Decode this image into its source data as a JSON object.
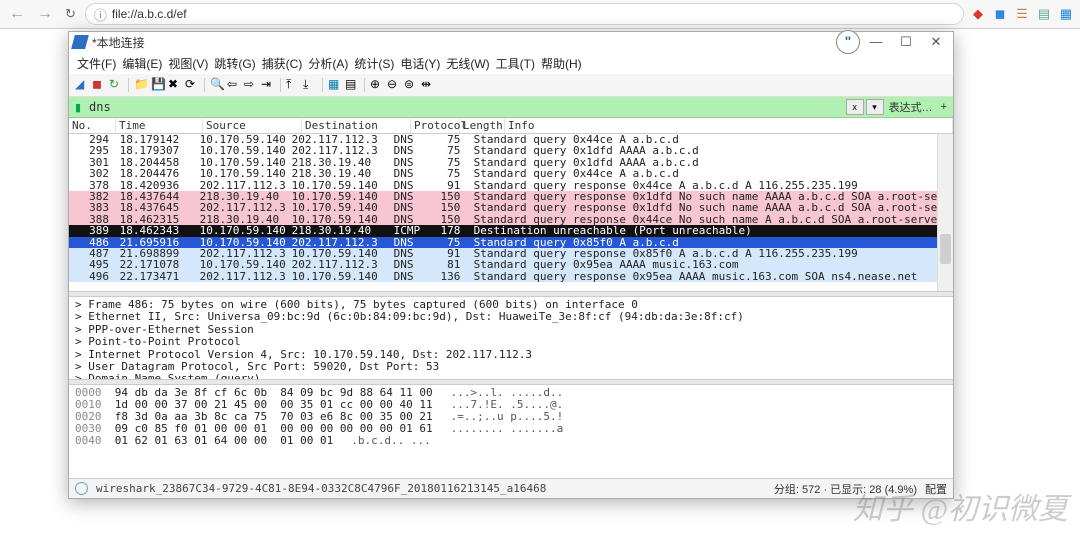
{
  "browser": {
    "url": "file://a.b.c.d/ef",
    "ext_colors": [
      "#d33",
      "#38d",
      "#c84",
      "#5a8",
      "#28d"
    ]
  },
  "window": {
    "title": "*本地连接",
    "menu": [
      "文件(F)",
      "编辑(E)",
      "视图(V)",
      "跳转(G)",
      "捕获(C)",
      "分析(A)",
      "统计(S)",
      "电话(Y)",
      "无线(W)",
      "工具(T)",
      "帮助(H)"
    ]
  },
  "filter": {
    "value": "dns",
    "expr_label": "表达式…"
  },
  "cols": {
    "no": "No.",
    "time": "Time",
    "src": "Source",
    "dst": "Destination",
    "proto": "Protocol",
    "len": "Length",
    "info": "Info"
  },
  "rows": [
    {
      "cls": "normal",
      "no": "294",
      "t": "18.179142",
      "s": "10.170.59.140",
      "d": "202.117.112.3",
      "p": "DNS",
      "l": "75",
      "i": "Standard query 0x44ce A a.b.c.d"
    },
    {
      "cls": "normal",
      "no": "295",
      "t": "18.179307",
      "s": "10.170.59.140",
      "d": "202.117.112.3",
      "p": "DNS",
      "l": "75",
      "i": "Standard query 0x1dfd AAAA a.b.c.d"
    },
    {
      "cls": "normal",
      "no": "301",
      "t": "18.204458",
      "s": "10.170.59.140",
      "d": "218.30.19.40",
      "p": "DNS",
      "l": "75",
      "i": "Standard query 0x1dfd AAAA a.b.c.d"
    },
    {
      "cls": "normal",
      "no": "302",
      "t": "18.204476",
      "s": "10.170.59.140",
      "d": "218.30.19.40",
      "p": "DNS",
      "l": "75",
      "i": "Standard query 0x44ce A a.b.c.d"
    },
    {
      "cls": "normal",
      "no": "378",
      "t": "18.420936",
      "s": "202.117.112.3",
      "d": "10.170.59.140",
      "p": "DNS",
      "l": "91",
      "i": "Standard query response 0x44ce A a.b.c.d A 116.255.235.199"
    },
    {
      "cls": "pink",
      "no": "382",
      "t": "18.437644",
      "s": "218.30.19.40",
      "d": "10.170.59.140",
      "p": "DNS",
      "l": "150",
      "i": "Standard query response 0x1dfd No such name AAAA a.b.c.d SOA a.root-servers.net"
    },
    {
      "cls": "pink",
      "no": "383",
      "t": "18.437645",
      "s": "202.117.112.3",
      "d": "10.170.59.140",
      "p": "DNS",
      "l": "150",
      "i": "Standard query response 0x1dfd No such name AAAA a.b.c.d SOA a.root-servers.net"
    },
    {
      "cls": "pink",
      "no": "388",
      "t": "18.462315",
      "s": "218.30.19.40",
      "d": "10.170.59.140",
      "p": "DNS",
      "l": "150",
      "i": "Standard query response 0x44ce No such name A a.b.c.d SOA a.root-servers.net"
    },
    {
      "cls": "black",
      "no": "389",
      "t": "18.462343",
      "s": "10.170.59.140",
      "d": "218.30.19.40",
      "p": "ICMP",
      "l": "178",
      "i": "Destination unreachable (Port unreachable)"
    },
    {
      "cls": "hl",
      "no": "486",
      "t": "21.695916",
      "s": "10.170.59.140",
      "d": "202.117.112.3",
      "p": "DNS",
      "l": "75",
      "i": "Standard query 0x85f0 A a.b.c.d"
    },
    {
      "cls": "blue",
      "no": "487",
      "t": "21.698899",
      "s": "202.117.112.3",
      "d": "10.170.59.140",
      "p": "DNS",
      "l": "91",
      "i": "Standard query response 0x85f0 A a.b.c.d A 116.255.235.199"
    },
    {
      "cls": "blue",
      "no": "495",
      "t": "22.171078",
      "s": "10.170.59.140",
      "d": "202.117.112.3",
      "p": "DNS",
      "l": "81",
      "i": "Standard query 0x95ea AAAA music.163.com"
    },
    {
      "cls": "blue",
      "no": "496",
      "t": "22.173471",
      "s": "202.117.112.3",
      "d": "10.170.59.140",
      "p": "DNS",
      "l": "136",
      "i": "Standard query response 0x95ea AAAA music.163.com SOA ns4.nease.net"
    }
  ],
  "detail": [
    "Frame 486: 75 bytes on wire (600 bits), 75 bytes captured (600 bits) on interface 0",
    "Ethernet II, Src: Universa_09:bc:9d (6c:0b:84:09:bc:9d), Dst: HuaweiTe_3e:8f:cf (94:db:da:3e:8f:cf)",
    "PPP-over-Ethernet Session",
    "Point-to-Point Protocol",
    "Internet Protocol Version 4, Src: 10.170.59.140, Dst: 202.117.112.3",
    "User Datagram Protocol, Src Port: 59020, Dst Port: 53",
    "Domain Name System (query)"
  ],
  "hex": [
    {
      "o": "0000",
      "b": "94 db da 3e 8f cf 6c 0b  84 09 bc 9d 88 64 11 00",
      "a": "...>..l. .....d.."
    },
    {
      "o": "0010",
      "b": "1d 00 00 37 00 21 45 00  00 35 01 cc 00 00 40 11",
      "a": "...7.!E. .5....@."
    },
    {
      "o": "0020",
      "b": "f8 3d 0a aa 3b 8c ca 75  70 03 e6 8c 00 35 00 21",
      "a": ".=..;..u p....5.!"
    },
    {
      "o": "0030",
      "b": "09 c0 85 f0 01 00 00 01  00 00 00 00 00 00 01 61",
      "a": "........ .......a"
    },
    {
      "o": "0040",
      "b": "01 62 01 63 01 64 00 00  01 00 01",
      "a": ".b.c.d.. ..."
    }
  ],
  "status": {
    "path": "wireshark_23867C34-9729-4C81-8E94-0332C8C4796F_20180116213145_a16468",
    "pkts_lbl": "分组:",
    "pkts": "572",
    "disp_lbl": "已显示:",
    "disp": "28 (4.9%)",
    "profile_lbl": "配置"
  },
  "watermark": "知乎 @初识微夏"
}
